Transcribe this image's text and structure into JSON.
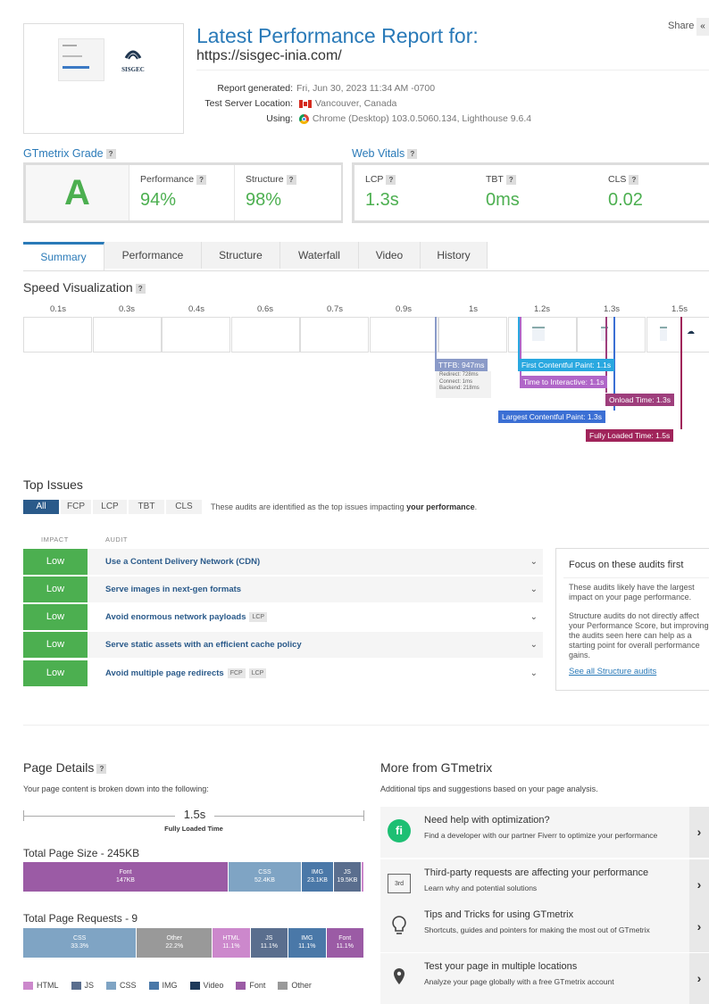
{
  "header": {
    "title": "Latest Performance Report for:",
    "url": "https://sisgec-inia.com/",
    "share_label": "Share",
    "share_btn": "«",
    "report_generated_label": "Report generated:",
    "report_generated_value": "Fri, Jun 30, 2023 11:34 AM -0700",
    "server_label": "Test Server Location:",
    "server_value": "Vancouver, Canada",
    "using_label": "Using:",
    "using_value": "Chrome (Desktop) 103.0.5060.134, Lighthouse 9.6.4",
    "thumb_logo_text": "SISGEC"
  },
  "grade": {
    "title": "GTmetrix Grade",
    "letter": "A",
    "performance_label": "Performance",
    "performance_value": "94%",
    "structure_label": "Structure",
    "structure_value": "98%"
  },
  "vitals": {
    "title": "Web Vitals",
    "lcp_label": "LCP",
    "lcp_value": "1.3s",
    "tbt_label": "TBT",
    "tbt_value": "0ms",
    "cls_label": "CLS",
    "cls_value": "0.02"
  },
  "tabs": [
    "Summary",
    "Performance",
    "Structure",
    "Waterfall",
    "Video",
    "History"
  ],
  "speed": {
    "title": "Speed Visualization",
    "ticks": [
      "0.1s",
      "0.3s",
      "0.4s",
      "0.6s",
      "0.7s",
      "0.9s",
      "1s",
      "1.2s",
      "1.3s",
      "1.5s"
    ],
    "markers": {
      "ttfb": "TTFB: 947ms",
      "redirect": "Redirect: 728ms",
      "connect": "Connect: 1ms",
      "backend": "Backend: 218ms",
      "fcp": "First Contentful Paint: 1.1s",
      "tti": "Time to Interactive: 1.1s",
      "onload": "Onload Time: 1.3s",
      "lcp": "Largest Contentful Paint: 1.3s",
      "fully": "Fully Loaded Time: 1.5s"
    }
  },
  "top_issues": {
    "title": "Top Issues",
    "filters": [
      "All",
      "FCP",
      "LCP",
      "TBT",
      "CLS"
    ],
    "description_prefix": "These audits are identified as the top issues impacting ",
    "description_bold": "your performance",
    "description_suffix": ".",
    "col_impact": "IMPACT",
    "col_audit": "AUDIT",
    "rows": [
      {
        "impact": "Low",
        "audit": "Use a Content Delivery Network (CDN)",
        "tags": []
      },
      {
        "impact": "Low",
        "audit": "Serve images in next-gen formats",
        "tags": []
      },
      {
        "impact": "Low",
        "audit": "Avoid enormous network payloads",
        "tags": [
          "LCP"
        ]
      },
      {
        "impact": "Low",
        "audit": "Serve static assets with an efficient cache policy",
        "tags": []
      },
      {
        "impact": "Low",
        "audit": "Avoid multiple page redirects",
        "tags": [
          "FCP",
          "LCP"
        ]
      }
    ],
    "focus": {
      "heading": "Focus on these audits first",
      "p1": "These audits likely have the largest impact on your page performance.",
      "p2": "Structure audits do not directly affect your Performance Score, but improving the audits seen here can help as a starting point for overall performance gains.",
      "link": "See all Structure audits"
    }
  },
  "page_details": {
    "title": "Page Details",
    "subtitle": "Your page content is broken down into the following:",
    "fully_loaded_value": "1.5s",
    "fully_loaded_label": "Fully Loaded Time",
    "size_title": "Total Page Size - 245KB",
    "size_segments": [
      {
        "name": "Font",
        "value": "147KB",
        "kb": 147,
        "color": "#9b5ba5"
      },
      {
        "name": "CSS",
        "value": "52.4KB",
        "kb": 52.4,
        "color": "#7fa4c4"
      },
      {
        "name": "IMG",
        "value": "23.1KB",
        "kb": 23.1,
        "color": "#4a78a8"
      },
      {
        "name": "JS",
        "value": "19.5KB",
        "kb": 19.5,
        "color": "#5a6e8e"
      },
      {
        "name": "",
        "value": "",
        "kb": 2.2,
        "color": "#cc88cc"
      }
    ],
    "requests_title": "Total Page Requests - 9",
    "request_segments": [
      {
        "name": "CSS",
        "value": "33.3%",
        "pct": 33.3,
        "color": "#7fa4c4"
      },
      {
        "name": "Other",
        "value": "22.2%",
        "pct": 22.2,
        "color": "#999999"
      },
      {
        "name": "HTML",
        "value": "11.1%",
        "pct": 11.1,
        "color": "#cc88cc"
      },
      {
        "name": "JS",
        "value": "11.1%",
        "pct": 11.1,
        "color": "#5a6e8e"
      },
      {
        "name": "IMG",
        "value": "11.1%",
        "pct": 11.1,
        "color": "#4a78a8"
      },
      {
        "name": "Font",
        "value": "11.1%",
        "pct": 11.1,
        "color": "#9b5ba5"
      }
    ],
    "legend": [
      {
        "name": "HTML",
        "color": "#cc88cc"
      },
      {
        "name": "JS",
        "color": "#5a6e8e"
      },
      {
        "name": "CSS",
        "color": "#7fa4c4"
      },
      {
        "name": "IMG",
        "color": "#4a78a8"
      },
      {
        "name": "Video",
        "color": "#1e3a5a"
      },
      {
        "name": "Font",
        "color": "#9b5ba5"
      },
      {
        "name": "Other",
        "color": "#999999"
      }
    ]
  },
  "more_from": {
    "title": "More from GTmetrix",
    "subtitle": "Additional tips and suggestions based on your page analysis.",
    "items": [
      {
        "icon": "fiverr-icon",
        "title": "Need help with optimization?",
        "sub": "Find a developer with our partner Fiverr to optimize your performance"
      },
      {
        "icon": "third-party-icon",
        "title": "Third-party requests are affecting your performance",
        "sub": "Learn why and potential solutions",
        "icon_text": "3rd"
      },
      {
        "icon": "lightbulb-icon",
        "title": "Tips and Tricks for using GTmetrix",
        "sub": "Shortcuts, guides and pointers for making the most out of GTmetrix"
      },
      {
        "icon": "location-pin-icon",
        "title": "Test your page in multiple locations",
        "sub": "Analyze your page globally with a free GTmetrix account"
      }
    ],
    "arrow": "›"
  }
}
